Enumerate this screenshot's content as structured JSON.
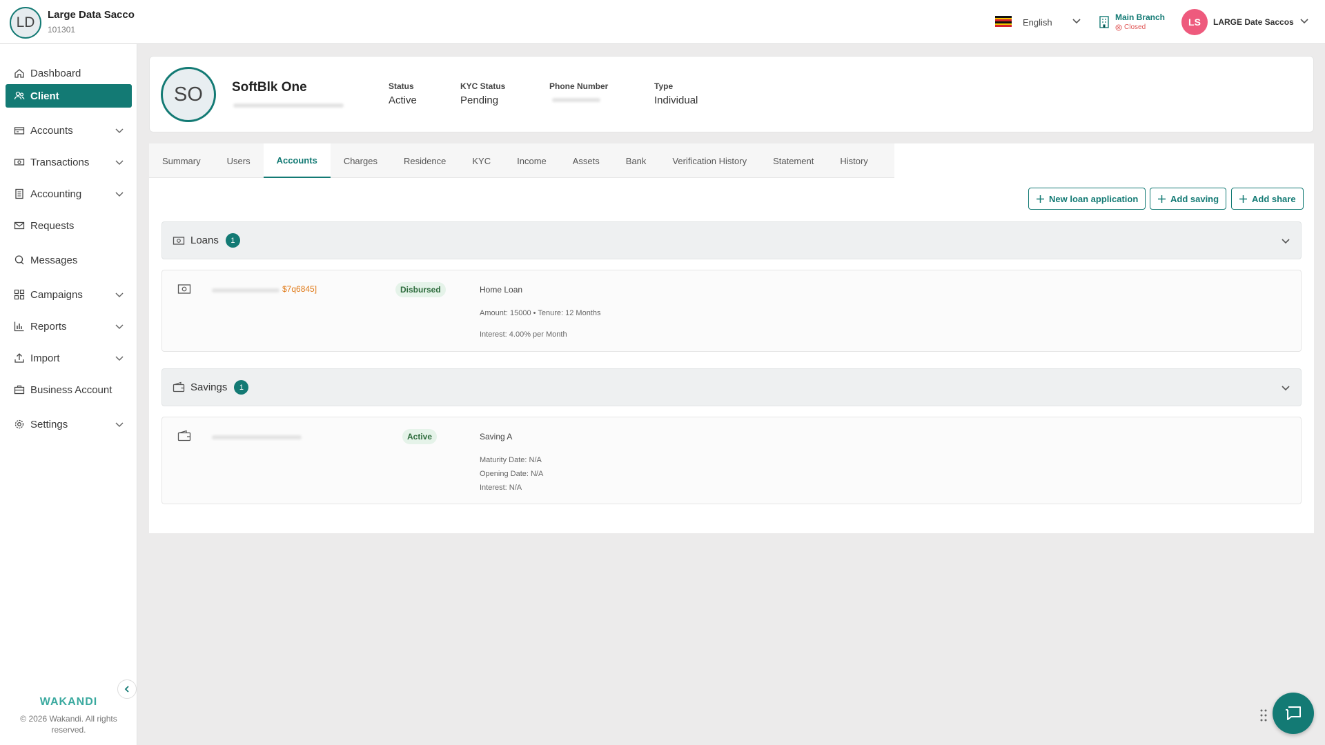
{
  "org": {
    "initials": "LD",
    "name": "Large Data Sacco",
    "code": "101301"
  },
  "header": {
    "language": "English",
    "branch_name": "Main Branch",
    "branch_status": "Closed",
    "user_initials": "LS",
    "user_name": "LARGE Date Saccos"
  },
  "sidebar": {
    "items": [
      {
        "label": "Dashboard",
        "icon": "home-icon"
      },
      {
        "label": "Client",
        "icon": "users-icon"
      },
      {
        "label": "Accounts",
        "icon": "bank-icon"
      },
      {
        "label": "Transactions",
        "icon": "cash-icon"
      },
      {
        "label": "Accounting",
        "icon": "ledger-icon"
      },
      {
        "label": "Requests",
        "icon": "mail-icon"
      },
      {
        "label": "Messages",
        "icon": "chat-icon"
      },
      {
        "label": "Campaigns",
        "icon": "grid-icon"
      },
      {
        "label": "Reports",
        "icon": "bar-chart-icon"
      },
      {
        "label": "Import",
        "icon": "upload-icon"
      },
      {
        "label": "Business Account",
        "icon": "briefcase-icon"
      },
      {
        "label": "Settings",
        "icon": "gear-icon"
      }
    ],
    "brand": "WAKANDI",
    "copyright": "© 2026 Wakandi. All rights reserved."
  },
  "client": {
    "initials": "SO",
    "name": "SoftBlk One",
    "status_label": "Status",
    "status_value": "Active",
    "kyc_label": "KYC Status",
    "kyc_value": "Pending",
    "phone_label": "Phone Number",
    "type_label": "Type",
    "type_value": "Individual"
  },
  "tabs": [
    "Summary",
    "Users",
    "Accounts",
    "Charges",
    "Residence",
    "KYC",
    "Income",
    "Assets",
    "Bank",
    "Verification History",
    "Statement",
    "History"
  ],
  "actions": {
    "new_loan": "New loan application",
    "add_saving": "Add saving",
    "add_share": "Add share"
  },
  "loans": {
    "title": "Loans",
    "count": "1",
    "item": {
      "ref": "$7q6845]",
      "status": "Disbursed",
      "product": "Home Loan",
      "amount_tenure": "Amount: 15000  •  Tenure: 12 Months",
      "interest": "Interest: 4.00% per Month"
    }
  },
  "savings": {
    "title": "Savings",
    "count": "1",
    "item": {
      "status": "Active",
      "product": "Saving A",
      "maturity": "Maturity Date: N/A",
      "opening": "Opening Date: N/A",
      "interest": "Interest: N/A"
    }
  },
  "colors": {
    "primary": "#137a74",
    "accent_pink": "#ee5a7d",
    "closed_red": "#e05656",
    "ref_orange": "#e07b1a"
  }
}
